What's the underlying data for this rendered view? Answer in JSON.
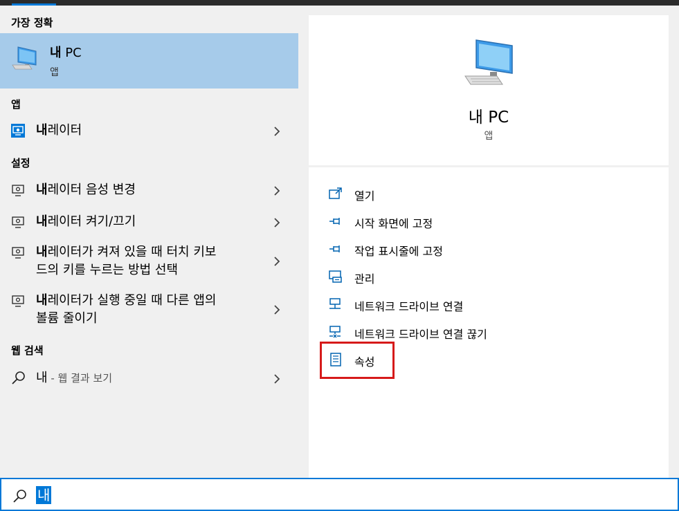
{
  "sections": {
    "best_match": "가장 정확",
    "apps": "앱",
    "settings": "설정",
    "web": "웹 검색"
  },
  "best": {
    "bold": "내",
    "rest": " PC",
    "type": "앱"
  },
  "apps": [
    {
      "bold": "내",
      "rest": "레이터"
    }
  ],
  "settings": [
    {
      "bold": "내",
      "line1": "레이터 음성 변경",
      "line2": ""
    },
    {
      "bold": "내",
      "line1": "레이터 켜기/끄기",
      "line2": ""
    },
    {
      "bold": "내",
      "line1": "레이터가 켜져 있을 때 터치 키보",
      "line2": "드의 키를 누르는 방법 선택"
    },
    {
      "bold": "내",
      "line1": "레이터가 실행 중일 때 다른 앱의",
      "line2": "볼륨 줄이기"
    }
  ],
  "web": {
    "term": "내",
    "suffix": " - 웹 결과 보기"
  },
  "detail": {
    "title": "내 PC",
    "type": "앱"
  },
  "actions": [
    {
      "label": "열기",
      "icon": "open-icon"
    },
    {
      "label": "시작 화면에 고정",
      "icon": "pin-icon"
    },
    {
      "label": "작업 표시줄에 고정",
      "icon": "pin-icon"
    },
    {
      "label": "관리",
      "icon": "manage-icon"
    },
    {
      "label": "네트워크 드라이브 연결",
      "icon": "network-drive-icon"
    },
    {
      "label": "네트워크 드라이브 연결 끊기",
      "icon": "network-drive-disconnect-icon"
    },
    {
      "label": "속성",
      "icon": "properties-icon"
    }
  ],
  "search": {
    "value": "내"
  },
  "colors": {
    "accent": "#0078d7",
    "selected": "#a6cbea",
    "highlight_box": "#d61a1a"
  }
}
